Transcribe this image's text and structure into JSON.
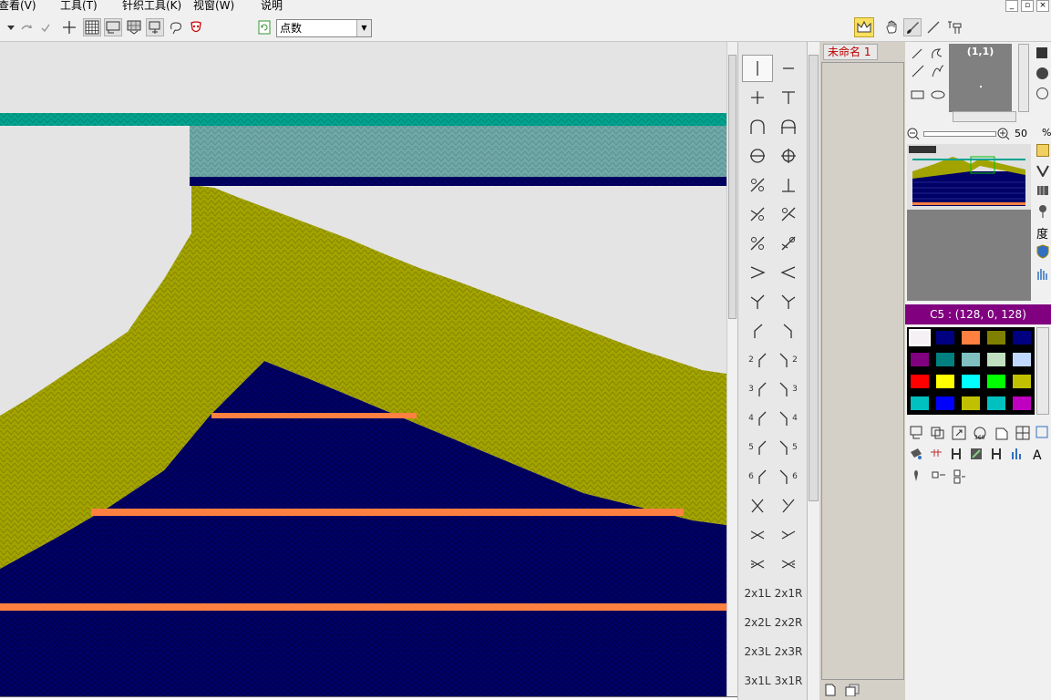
{
  "menu": [
    "查看(V)",
    "工具(T)",
    "针织工具(K)",
    "视窗(W)",
    "说明"
  ],
  "window_controls": [
    "_",
    "▫",
    "×"
  ],
  "toolbar": {
    "mode_select": "点数"
  },
  "stitches": {
    "labels": [
      "2x1L",
      "2x1R",
      "2x2L",
      "2x2R",
      "2x3L",
      "2x3R",
      "3x1L",
      "3x1R"
    ],
    "numbers": [
      "2",
      "2",
      "3",
      "3",
      "4",
      "4",
      "5",
      "5",
      "6",
      "6"
    ]
  },
  "document": {
    "tab_title": "未命名 1"
  },
  "navigator": {
    "coords": "(1,1)",
    "zoom_value": "50",
    "zoom_unit": "%"
  },
  "color_info": "C5 : (128, 0, 128)",
  "side_label": "度",
  "palette": [
    "#f4f0f4",
    "#000080",
    "#ff8040",
    "#808000",
    "#000080",
    "#800080",
    "#008080",
    "#80c0c0",
    "#c0e0c0",
    "#c0d8ff",
    "#ff0000",
    "#ffff00",
    "#00ffff",
    "#00ff00",
    "#c0c000",
    "#00c0c0",
    "#0000ff",
    "#c0c000",
    "#00c0c0",
    "#c000c0"
  ],
  "knit_colors": {
    "navy": "#000066",
    "olive": "#a3a300",
    "teal": "#00a38f",
    "aqua": "#70a8a8",
    "orange": "#ff8040"
  }
}
